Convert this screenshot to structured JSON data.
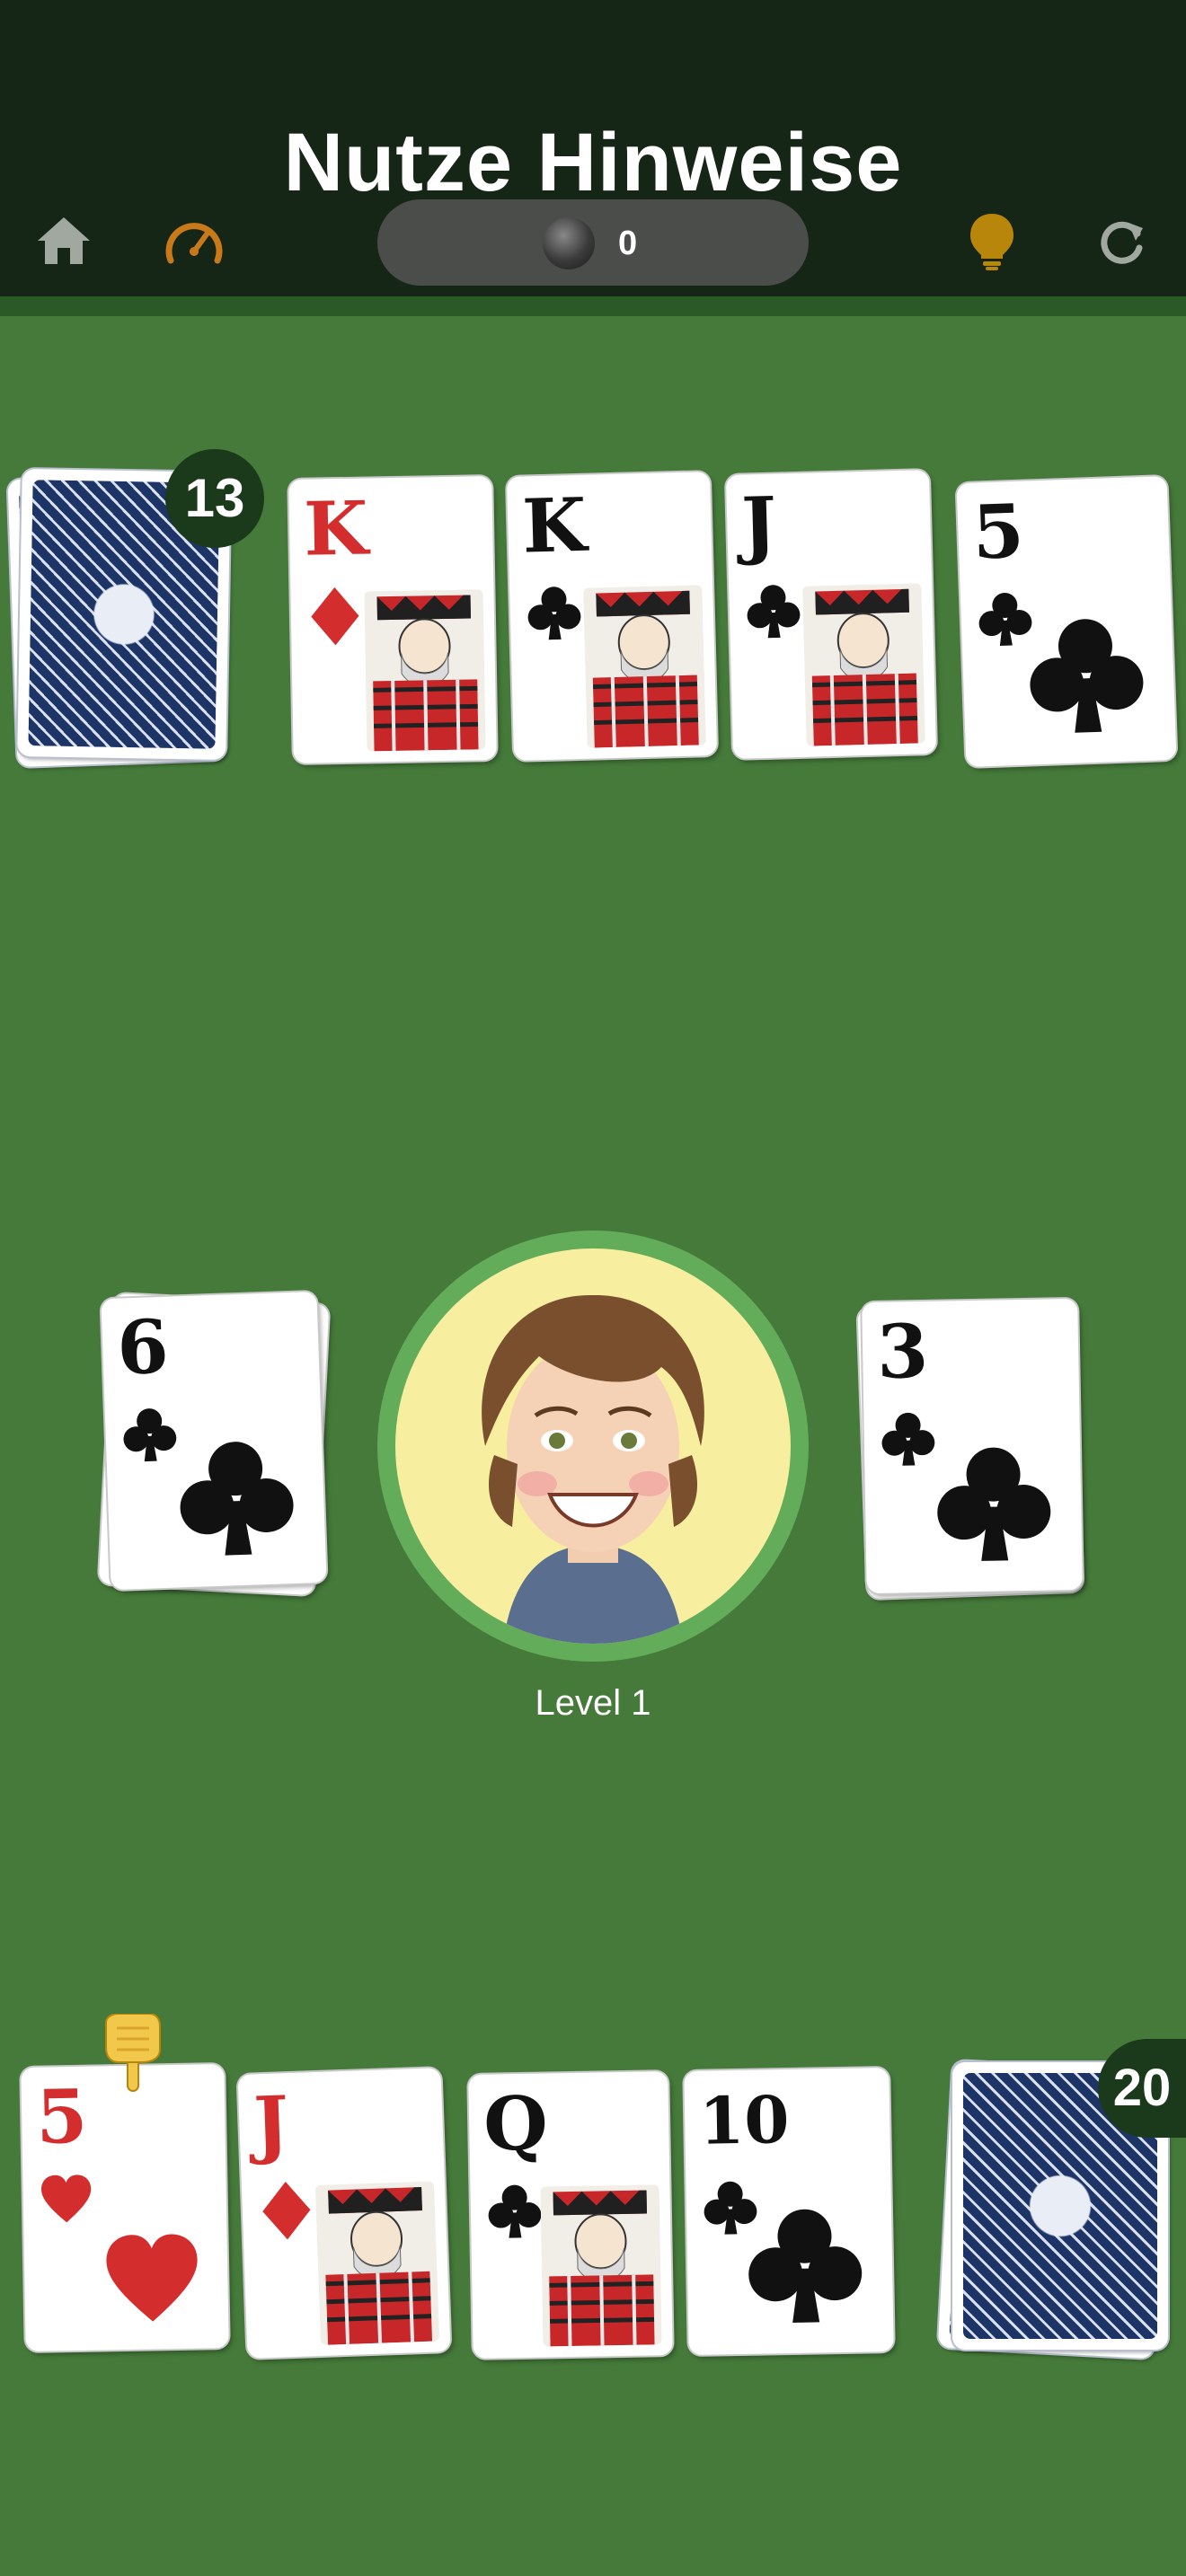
{
  "header": {
    "title": "Nutze Hinweise",
    "coins": "0",
    "icons": [
      "home-icon",
      "speedometer-icon",
      "coin-icon",
      "lightbulb-icon",
      "refresh-icon"
    ],
    "colors": {
      "bar": "#162616",
      "table": "#457a3a",
      "hint": "#b8860b",
      "speed": "#c87a1a"
    }
  },
  "opponent": {
    "deck_count": "13",
    "cards": [
      {
        "rank": "K",
        "suit": "diamonds"
      },
      {
        "rank": "K",
        "suit": "clubs"
      },
      {
        "rank": "J",
        "suit": "clubs"
      },
      {
        "rank": "5",
        "suit": "clubs"
      }
    ]
  },
  "center": {
    "left_pile": {
      "rank": "6",
      "suit": "clubs"
    },
    "right_pile": {
      "rank": "3",
      "suit": "clubs"
    },
    "avatar_label": "Level 1"
  },
  "player": {
    "deck_count": "20",
    "cards": [
      {
        "rank": "5",
        "suit": "hearts"
      },
      {
        "rank": "J",
        "suit": "diamonds"
      },
      {
        "rank": "Q",
        "suit": "clubs"
      },
      {
        "rank": "10",
        "suit": "clubs"
      }
    ],
    "hint_pointer": "pointing-hand-icon"
  }
}
